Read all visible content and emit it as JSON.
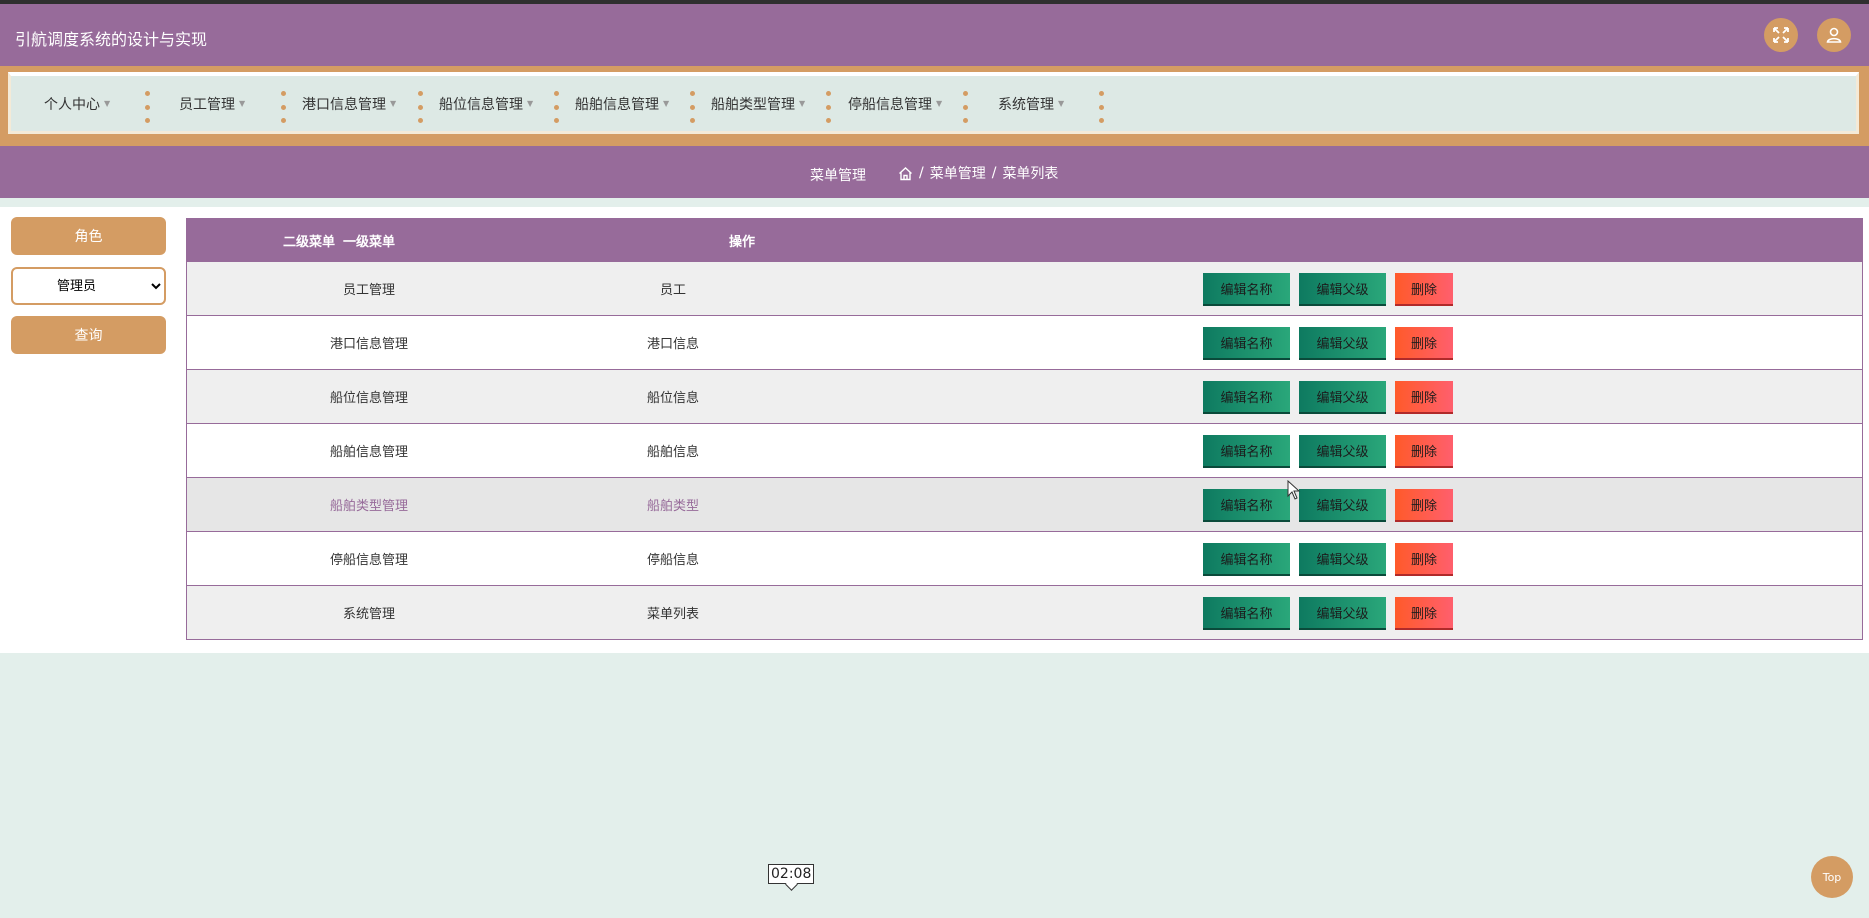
{
  "app": {
    "title": "引航调度系统的设计与实现"
  },
  "header": {
    "icons": [
      "fullscreen-icon",
      "user-icon"
    ]
  },
  "nav": {
    "items": [
      {
        "label": "个人中心"
      },
      {
        "label": "员工管理"
      },
      {
        "label": "港口信息管理"
      },
      {
        "label": "船位信息管理"
      },
      {
        "label": "船舶信息管理"
      },
      {
        "label": "船舶类型管理"
      },
      {
        "label": "停船信息管理"
      },
      {
        "label": "系统管理"
      }
    ]
  },
  "breadcrumb": {
    "current": "菜单管理",
    "path1": "菜单管理",
    "sep": "/",
    "path2": "菜单列表"
  },
  "sidebar": {
    "role_button": "角色",
    "role_selected": "管理员",
    "query_button": "查询"
  },
  "table": {
    "headers": [
      "一级菜单",
      "二级菜单",
      "操作"
    ],
    "rows": [
      {
        "level1": "员工管理",
        "level2": "员工"
      },
      {
        "level1": "港口信息管理",
        "level2": "港口信息"
      },
      {
        "level1": "船位信息管理",
        "level2": "船位信息"
      },
      {
        "level1": "船舶信息管理",
        "level2": "船舶信息"
      },
      {
        "level1": "船舶类型管理",
        "level2": "船舶类型"
      },
      {
        "level1": "停船信息管理",
        "level2": "停船信息"
      },
      {
        "level1": "系统管理",
        "level2": "菜单列表"
      }
    ],
    "actions": {
      "edit_name": "编辑名称",
      "edit_parent": "编辑父级",
      "delete": "删除"
    }
  },
  "overlay": {
    "time": "02:08",
    "top_button": "Top"
  },
  "colors": {
    "primary": "#976b9a",
    "accent": "#d49c63",
    "green": "#1b9470",
    "red": "#ff5a4a",
    "bg": "#e3efeb"
  }
}
